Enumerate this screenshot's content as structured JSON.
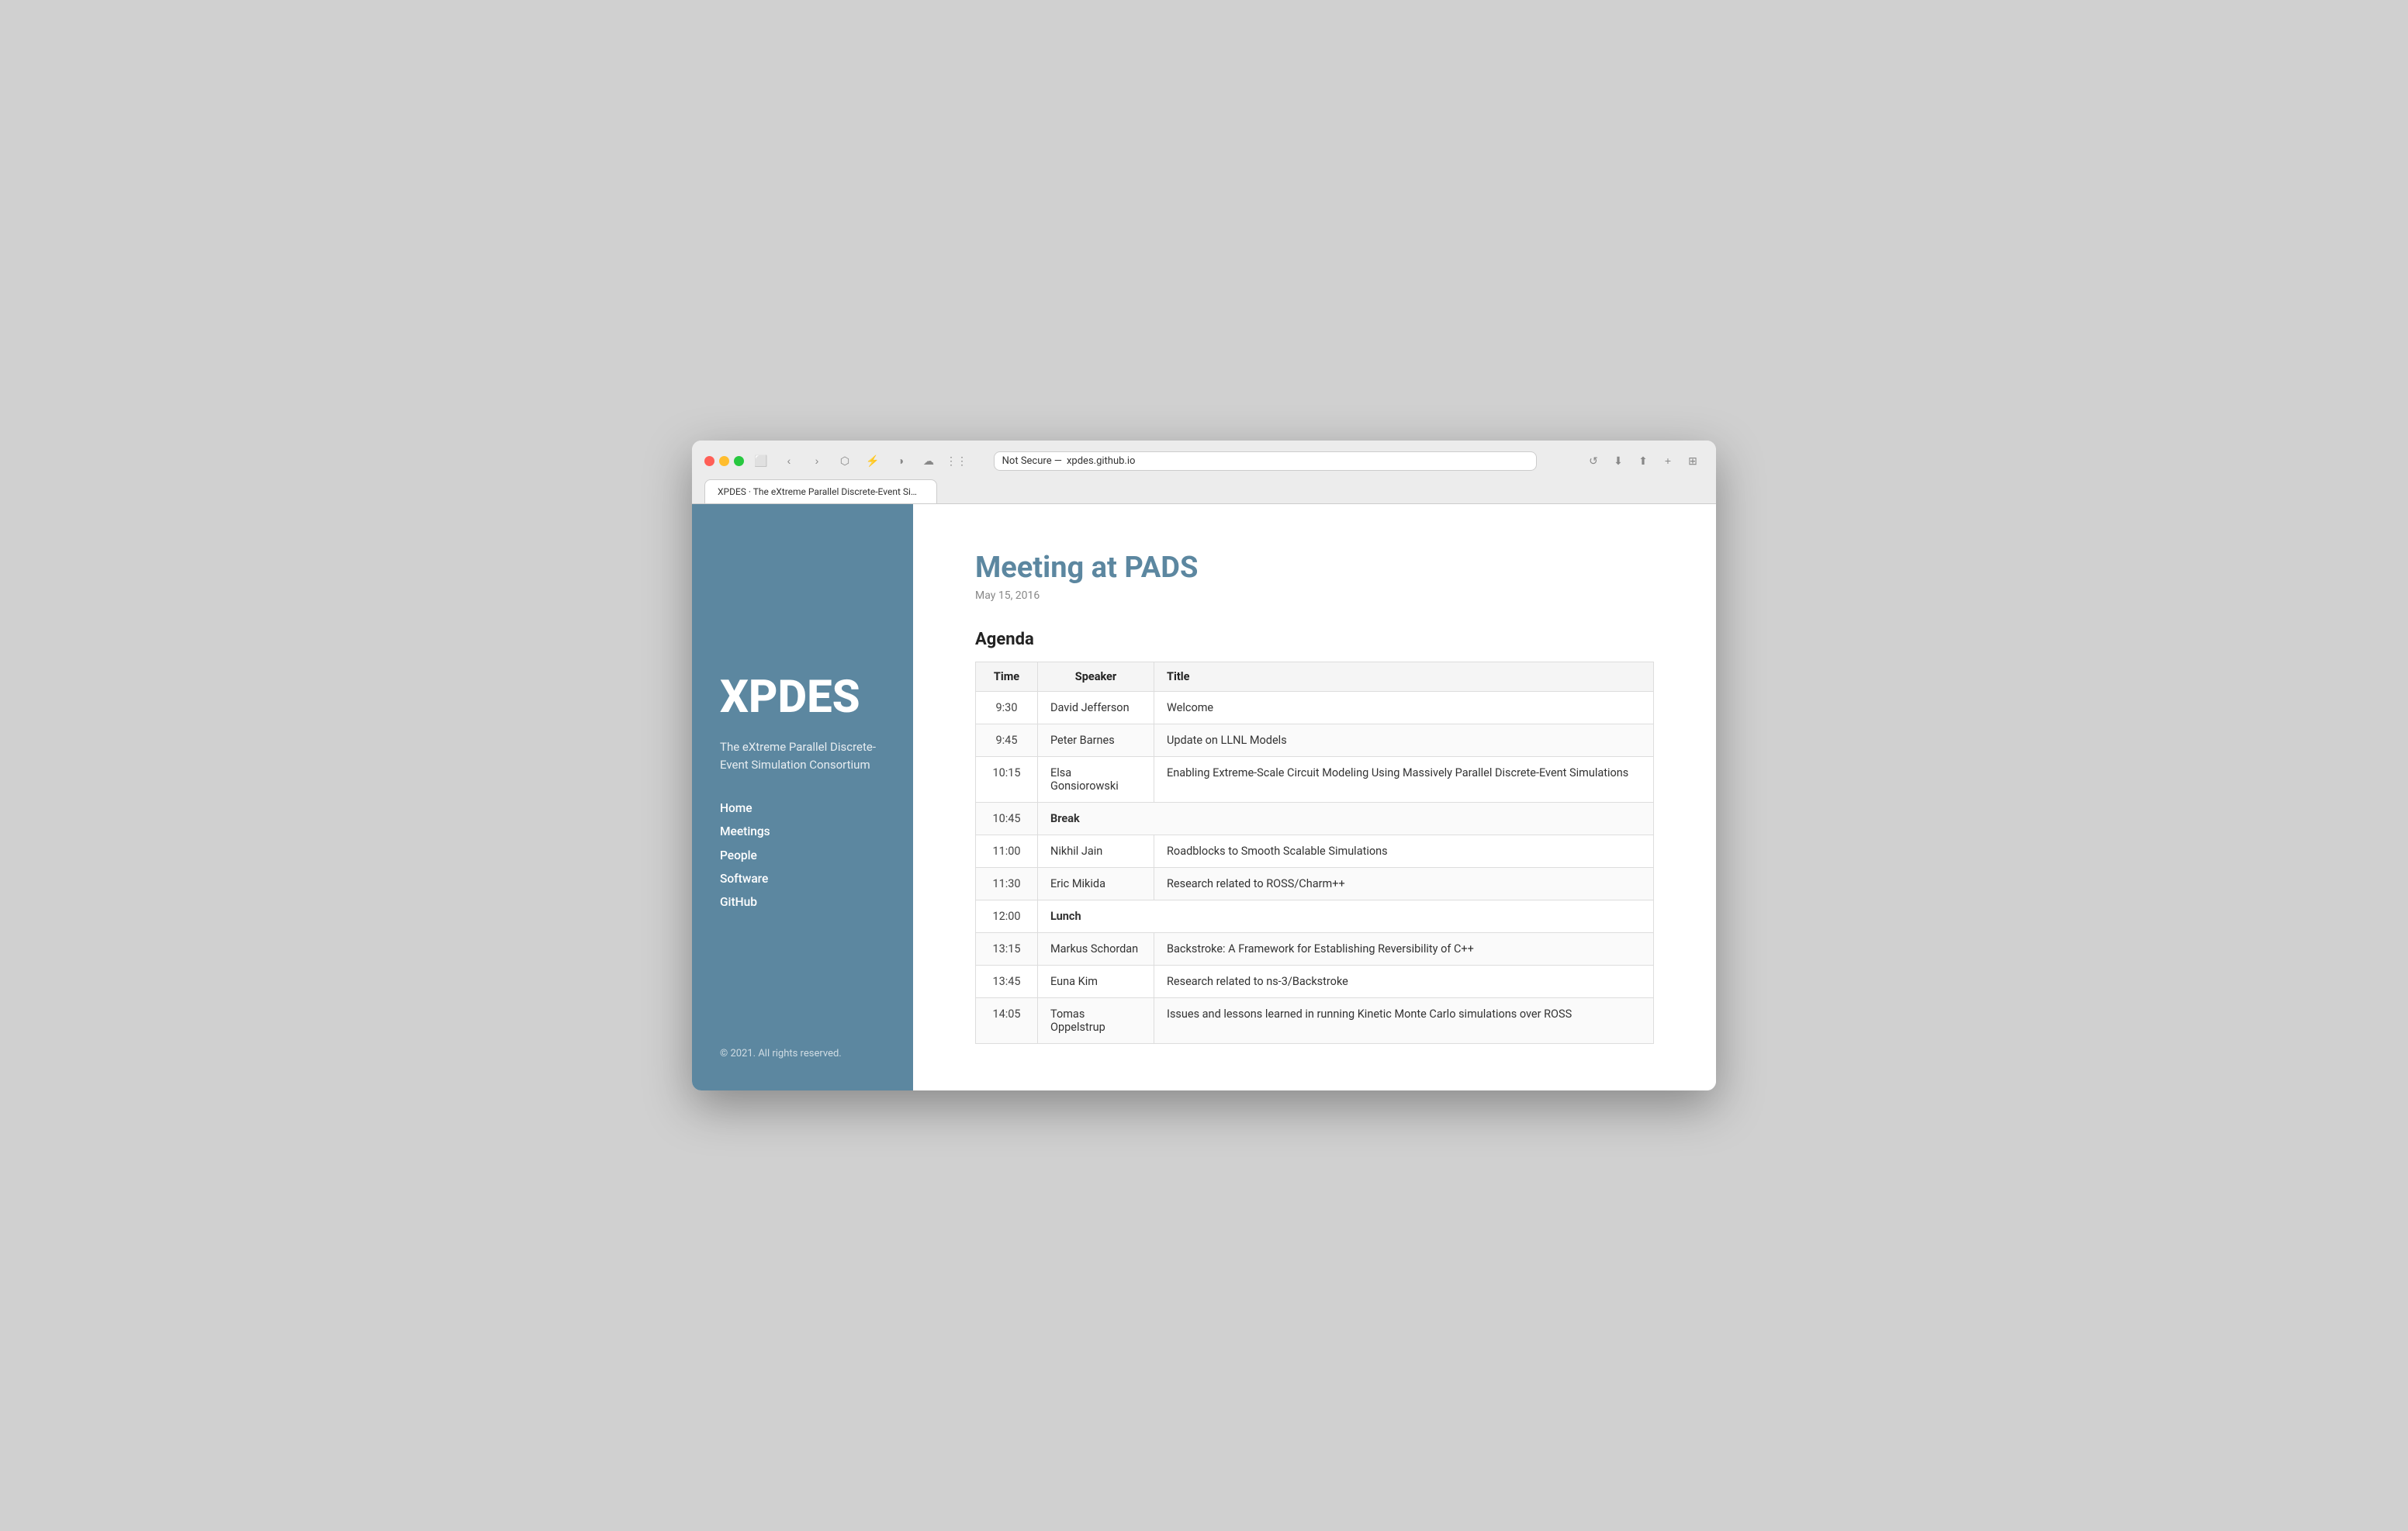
{
  "browser": {
    "tab_title": "XPDES · The eXtreme Parallel Discrete-Event Simulation Consortium",
    "address_not_secure": "Not Secure —",
    "address_domain": "xpdes.github.io"
  },
  "sidebar": {
    "logo": "XPDES",
    "description": "The eXtreme Parallel Discrete-Event Simulation Consortium",
    "nav_items": [
      {
        "label": "Home",
        "href": "#"
      },
      {
        "label": "Meetings",
        "href": "#"
      },
      {
        "label": "People",
        "href": "#"
      },
      {
        "label": "Software",
        "href": "#"
      },
      {
        "label": "GitHub",
        "href": "#"
      }
    ],
    "copyright": "© 2021. All rights reserved."
  },
  "main": {
    "page_title": "Meeting at PADS",
    "page_date": "May 15, 2016",
    "section_title": "Agenda",
    "table": {
      "headers": [
        "Time",
        "Speaker",
        "Title"
      ],
      "rows": [
        {
          "time": "9:30",
          "speaker": "David Jefferson",
          "title": "Welcome",
          "bold": false
        },
        {
          "time": "9:45",
          "speaker": "Peter Barnes",
          "title": "Update on LLNL Models",
          "bold": false
        },
        {
          "time": "10:15",
          "speaker": "Elsa Gonsiorowski",
          "title": "Enabling Extreme-Scale Circuit Modeling Using Massively Parallel Discrete-Event Simulations",
          "bold": false
        },
        {
          "time": "10:45",
          "speaker": "Break",
          "title": "",
          "bold": true,
          "break": true
        },
        {
          "time": "11:00",
          "speaker": "Nikhil Jain",
          "title": "Roadblocks to Smooth Scalable Simulations",
          "bold": false
        },
        {
          "time": "11:30",
          "speaker": "Eric Mikida",
          "title": "Research related to ROSS/Charm++",
          "bold": false
        },
        {
          "time": "12:00",
          "speaker": "Lunch",
          "title": "",
          "bold": true,
          "break": true
        },
        {
          "time": "13:15",
          "speaker": "Markus Schordan",
          "title": "Backstroke: A Framework for Establishing Reversibility of C++",
          "bold": false
        },
        {
          "time": "13:45",
          "speaker": "Euna Kim",
          "title": "Research related to ns-3/Backstroke",
          "bold": false
        },
        {
          "time": "14:05",
          "speaker": "Tomas Oppelstrup",
          "title": "Issues and lessons learned in running Kinetic Monte Carlo simulations over ROSS",
          "bold": false
        }
      ]
    }
  }
}
